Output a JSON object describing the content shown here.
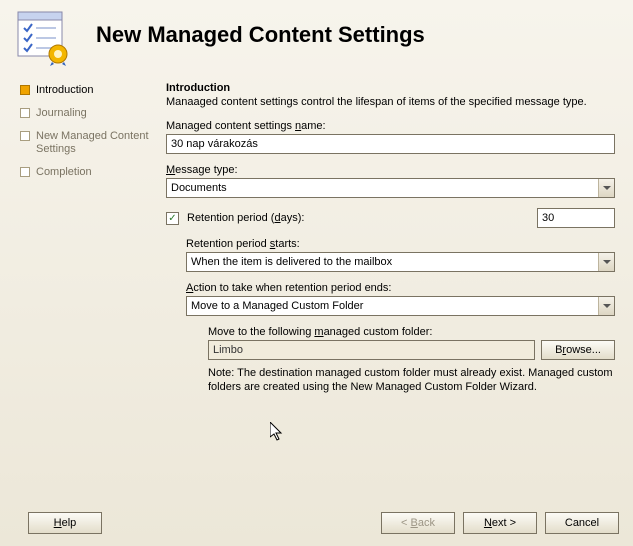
{
  "header": {
    "title": "New Managed Content Settings"
  },
  "nav": {
    "items": [
      {
        "label": "Introduction",
        "active": true
      },
      {
        "label": "Journaling",
        "active": false
      },
      {
        "label": "New Managed Content Settings",
        "active": false
      },
      {
        "label": "Completion",
        "active": false
      }
    ]
  },
  "main": {
    "section_title": "Introduction",
    "intro_text": "Manaaged content settings control the lifespan of items of the specified message type.",
    "name_label": "Managed content settings name:",
    "name_value": "30 nap várakozás",
    "type_label": "Message type:",
    "type_value": "Documents",
    "retention_check_label": "Retention period (days):",
    "retention_value": "30",
    "retention_starts_label": "Retention period starts:",
    "retention_starts_value": "When the item is delivered to the mailbox",
    "action_label": "Action to take when retention period ends:",
    "action_value": "Move to a Managed Custom Folder",
    "move_to_label": "Move to the following managed custom folder:",
    "move_to_value": "Limbo",
    "browse_label": "Browse...",
    "note": "Note: The destination managed custom folder must already exist. Managed custom folders are created using the New Managed Custom Folder Wizard."
  },
  "footer": {
    "help": "Help",
    "back": "< Back",
    "next": "Next >",
    "cancel": "Cancel"
  }
}
